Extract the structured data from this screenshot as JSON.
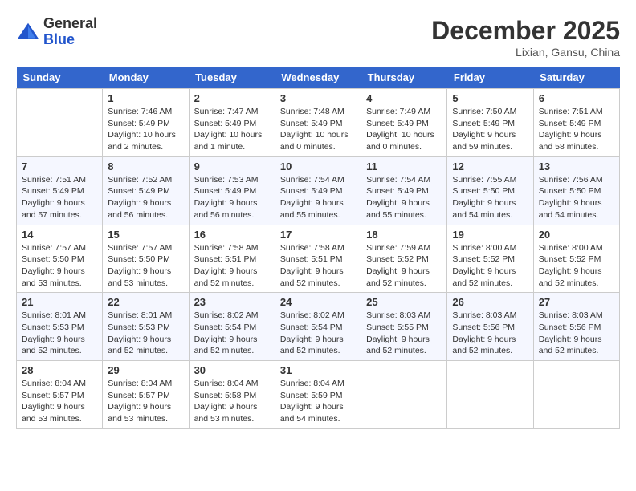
{
  "header": {
    "logo_general": "General",
    "logo_blue": "Blue",
    "month_title": "December 2025",
    "location": "Lixian, Gansu, China"
  },
  "columns": [
    "Sunday",
    "Monday",
    "Tuesday",
    "Wednesday",
    "Thursday",
    "Friday",
    "Saturday"
  ],
  "weeks": [
    [
      {
        "day": "",
        "info": ""
      },
      {
        "day": "1",
        "info": "Sunrise: 7:46 AM\nSunset: 5:49 PM\nDaylight: 10 hours\nand 2 minutes."
      },
      {
        "day": "2",
        "info": "Sunrise: 7:47 AM\nSunset: 5:49 PM\nDaylight: 10 hours\nand 1 minute."
      },
      {
        "day": "3",
        "info": "Sunrise: 7:48 AM\nSunset: 5:49 PM\nDaylight: 10 hours\nand 0 minutes."
      },
      {
        "day": "4",
        "info": "Sunrise: 7:49 AM\nSunset: 5:49 PM\nDaylight: 10 hours\nand 0 minutes."
      },
      {
        "day": "5",
        "info": "Sunrise: 7:50 AM\nSunset: 5:49 PM\nDaylight: 9 hours\nand 59 minutes."
      },
      {
        "day": "6",
        "info": "Sunrise: 7:51 AM\nSunset: 5:49 PM\nDaylight: 9 hours\nand 58 minutes."
      }
    ],
    [
      {
        "day": "7",
        "info": "Sunrise: 7:51 AM\nSunset: 5:49 PM\nDaylight: 9 hours\nand 57 minutes."
      },
      {
        "day": "8",
        "info": "Sunrise: 7:52 AM\nSunset: 5:49 PM\nDaylight: 9 hours\nand 56 minutes."
      },
      {
        "day": "9",
        "info": "Sunrise: 7:53 AM\nSunset: 5:49 PM\nDaylight: 9 hours\nand 56 minutes."
      },
      {
        "day": "10",
        "info": "Sunrise: 7:54 AM\nSunset: 5:49 PM\nDaylight: 9 hours\nand 55 minutes."
      },
      {
        "day": "11",
        "info": "Sunrise: 7:54 AM\nSunset: 5:49 PM\nDaylight: 9 hours\nand 55 minutes."
      },
      {
        "day": "12",
        "info": "Sunrise: 7:55 AM\nSunset: 5:50 PM\nDaylight: 9 hours\nand 54 minutes."
      },
      {
        "day": "13",
        "info": "Sunrise: 7:56 AM\nSunset: 5:50 PM\nDaylight: 9 hours\nand 54 minutes."
      }
    ],
    [
      {
        "day": "14",
        "info": "Sunrise: 7:57 AM\nSunset: 5:50 PM\nDaylight: 9 hours\nand 53 minutes."
      },
      {
        "day": "15",
        "info": "Sunrise: 7:57 AM\nSunset: 5:50 PM\nDaylight: 9 hours\nand 53 minutes."
      },
      {
        "day": "16",
        "info": "Sunrise: 7:58 AM\nSunset: 5:51 PM\nDaylight: 9 hours\nand 52 minutes."
      },
      {
        "day": "17",
        "info": "Sunrise: 7:58 AM\nSunset: 5:51 PM\nDaylight: 9 hours\nand 52 minutes."
      },
      {
        "day": "18",
        "info": "Sunrise: 7:59 AM\nSunset: 5:52 PM\nDaylight: 9 hours\nand 52 minutes."
      },
      {
        "day": "19",
        "info": "Sunrise: 8:00 AM\nSunset: 5:52 PM\nDaylight: 9 hours\nand 52 minutes."
      },
      {
        "day": "20",
        "info": "Sunrise: 8:00 AM\nSunset: 5:52 PM\nDaylight: 9 hours\nand 52 minutes."
      }
    ],
    [
      {
        "day": "21",
        "info": "Sunrise: 8:01 AM\nSunset: 5:53 PM\nDaylight: 9 hours\nand 52 minutes."
      },
      {
        "day": "22",
        "info": "Sunrise: 8:01 AM\nSunset: 5:53 PM\nDaylight: 9 hours\nand 52 minutes."
      },
      {
        "day": "23",
        "info": "Sunrise: 8:02 AM\nSunset: 5:54 PM\nDaylight: 9 hours\nand 52 minutes."
      },
      {
        "day": "24",
        "info": "Sunrise: 8:02 AM\nSunset: 5:54 PM\nDaylight: 9 hours\nand 52 minutes."
      },
      {
        "day": "25",
        "info": "Sunrise: 8:03 AM\nSunset: 5:55 PM\nDaylight: 9 hours\nand 52 minutes."
      },
      {
        "day": "26",
        "info": "Sunrise: 8:03 AM\nSunset: 5:56 PM\nDaylight: 9 hours\nand 52 minutes."
      },
      {
        "day": "27",
        "info": "Sunrise: 8:03 AM\nSunset: 5:56 PM\nDaylight: 9 hours\nand 52 minutes."
      }
    ],
    [
      {
        "day": "28",
        "info": "Sunrise: 8:04 AM\nSunset: 5:57 PM\nDaylight: 9 hours\nand 53 minutes."
      },
      {
        "day": "29",
        "info": "Sunrise: 8:04 AM\nSunset: 5:57 PM\nDaylight: 9 hours\nand 53 minutes."
      },
      {
        "day": "30",
        "info": "Sunrise: 8:04 AM\nSunset: 5:58 PM\nDaylight: 9 hours\nand 53 minutes."
      },
      {
        "day": "31",
        "info": "Sunrise: 8:04 AM\nSunset: 5:59 PM\nDaylight: 9 hours\nand 54 minutes."
      },
      {
        "day": "",
        "info": ""
      },
      {
        "day": "",
        "info": ""
      },
      {
        "day": "",
        "info": ""
      }
    ]
  ]
}
